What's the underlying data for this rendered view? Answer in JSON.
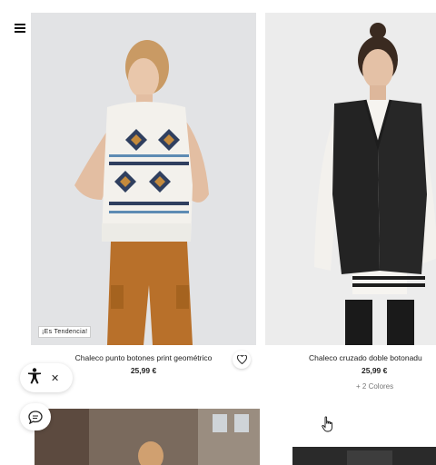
{
  "products": [
    {
      "tag": "¡Es Tendencia!",
      "title": "Chaleco punto botones print geométrico",
      "price": "25,99 €"
    },
    {
      "title": "Chaleco cruzado doble botonadu",
      "price": "25,99 €",
      "colors": "+ 2 Colores"
    }
  ],
  "icons": {
    "menu": "hamburger-menu-icon",
    "favorite": "heart-icon",
    "accessibility": "accessibility-person-icon",
    "close": "close-icon",
    "chat": "chat-bubble-icon",
    "cursor": "hand-pointer-icon"
  },
  "colors": {
    "background": "#ffffff",
    "text": "#222222",
    "muted": "#777777"
  }
}
